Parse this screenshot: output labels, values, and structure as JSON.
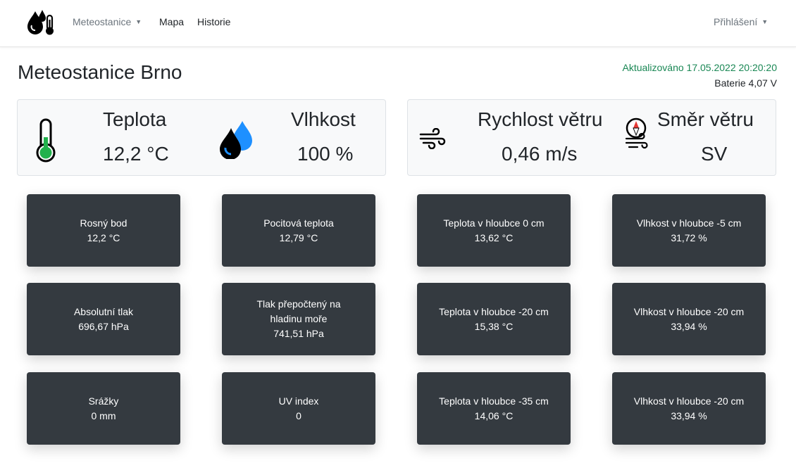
{
  "nav": {
    "brand_icon": "weather-station-logo-icon",
    "items": [
      {
        "label": "Meteostanice",
        "dropdown": true
      },
      {
        "label": "Mapa",
        "dropdown": false
      },
      {
        "label": "Historie",
        "dropdown": false
      }
    ],
    "login": {
      "label": "Přihlášení",
      "dropdown": true
    }
  },
  "header": {
    "title": "Meteostanice Brno",
    "updated": "Aktualizováno 17.05.2022 20:20:20",
    "battery": "Baterie 4,07 V"
  },
  "main_cards": [
    {
      "label": "Teplota",
      "value": "12,2 °C",
      "icon": "thermometer-icon"
    },
    {
      "label": "Vlhkost",
      "value": "100 %",
      "icon": "water-drops-icon"
    },
    {
      "label": "Rychlost větru",
      "value": "0,46 m/s",
      "icon": "wind-icon"
    },
    {
      "label": "Směr větru",
      "value": "SV",
      "icon": "compass-wind-icon"
    }
  ],
  "tiles": [
    {
      "label": "Rosný bod",
      "value": "12,2 °C"
    },
    {
      "label": "Pocitová teplota",
      "value": "12,79 °C"
    },
    {
      "label": "Teplota v hloubce 0 cm",
      "value": "13,62 °C"
    },
    {
      "label": "Vlhkost v hloubce -5 cm",
      "value": "31,72 %"
    },
    {
      "label": "Absolutní tlak",
      "value": "696,67 hPa"
    },
    {
      "label": "Tlak přepočtený na hladinu moře",
      "value": "741,51 hPa"
    },
    {
      "label": "Teplota v hloubce -20 cm",
      "value": "15,38 °C"
    },
    {
      "label": "Vlhkost v hloubce -20 cm",
      "value": "33,94 %"
    },
    {
      "label": "Srážky",
      "value": "0 mm"
    },
    {
      "label": "UV index",
      "value": "0"
    },
    {
      "label": "Teplota v hloubce -35 cm",
      "value": "14,06 °C"
    },
    {
      "label": "Vlhkost v hloubce -20 cm",
      "value": "33,94 %"
    }
  ],
  "colors": {
    "updated_text": "#198754",
    "tile_bg": "#343a40",
    "thermometer_fill": "#22b14c",
    "drop_blue": "#1e90ff"
  }
}
